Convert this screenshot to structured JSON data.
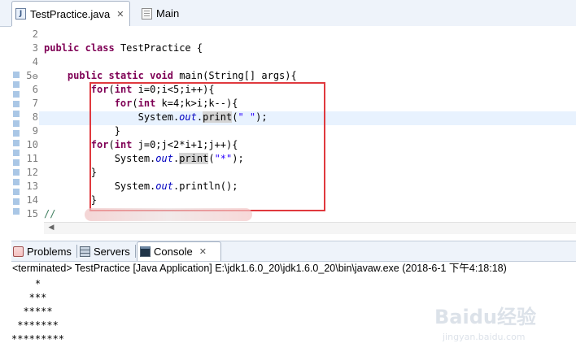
{
  "editor_tabs": {
    "testpractice": {
      "label": "TestPractice.java",
      "icon": "java-file-icon",
      "close": "✕"
    },
    "main": {
      "label": "Main",
      "icon": "text-file-icon"
    }
  },
  "line_numbers": [
    "2",
    "3",
    "4",
    "5",
    "6",
    "7",
    "8",
    "9",
    "10",
    "11",
    "12",
    "13",
    "14",
    "15"
  ],
  "fold_marker": "⊖",
  "code": {
    "l2": "",
    "l3": {
      "kw1": "public",
      "kw2": "class",
      "rest": " TestPractice {"
    },
    "l4": "",
    "l5": {
      "indent": "    ",
      "kw1": "public",
      "kw2": "static",
      "kw3": "void",
      "rest": " main(String[] args){"
    },
    "l6": {
      "indent": "        ",
      "kw1": "for",
      "p1": "(",
      "kw2": "int",
      "rest": " i=0;i<5;i++){"
    },
    "l7": {
      "indent": "            ",
      "kw1": "for",
      "p1": "(",
      "kw2": "int",
      "rest": " k=4;k>i;k--){"
    },
    "l8": {
      "indent": "                ",
      "pre": "System.",
      "field": "out",
      "dot": ".",
      "method": "print",
      "p1": "(",
      "str": "\" \"",
      "rest": ");"
    },
    "l9": {
      "indent": "            ",
      "rest": "}"
    },
    "l10": {
      "indent": "        ",
      "kw1": "for",
      "p1": "(",
      "kw2": "int",
      "rest": " j=0;j<2*i+1;j++){"
    },
    "l11": {
      "indent": "            ",
      "pre": "System.",
      "field": "out",
      "dot": ".",
      "method": "print",
      "p1": "(",
      "str": "\"*\"",
      "rest": ");"
    },
    "l12": {
      "indent": "        ",
      "rest": "}"
    },
    "l13": {
      "indent": "            ",
      "pre": "System.",
      "field": "out",
      "dot": ".",
      "method": "println",
      "rest": "();"
    },
    "l14": {
      "indent": "        ",
      "rest": "}"
    },
    "l15": {
      "comment": "//"
    }
  },
  "view_tabs": {
    "problems": {
      "label": "Problems",
      "icon": "problems-icon"
    },
    "servers": {
      "label": "Servers",
      "icon": "servers-icon"
    },
    "console": {
      "label": "Console",
      "icon": "console-icon",
      "close": "✕"
    }
  },
  "console": {
    "header": "<terminated> TestPractice [Java Application] E:\\jdk1.6.0_20\\jdk1.6.0_20\\bin\\javaw.exe (2018-6-1 下午4:18:18)",
    "output": [
      "    *",
      "   ***",
      "  *****",
      " *******",
      "*********"
    ]
  },
  "watermark": {
    "brand": "Baidu经验",
    "url": "jingyan.baidu.com"
  },
  "colors": {
    "keyword": "#7f0055",
    "field": "#0000c0",
    "string": "#2a00ff",
    "annotation_box": "#e0393e"
  }
}
